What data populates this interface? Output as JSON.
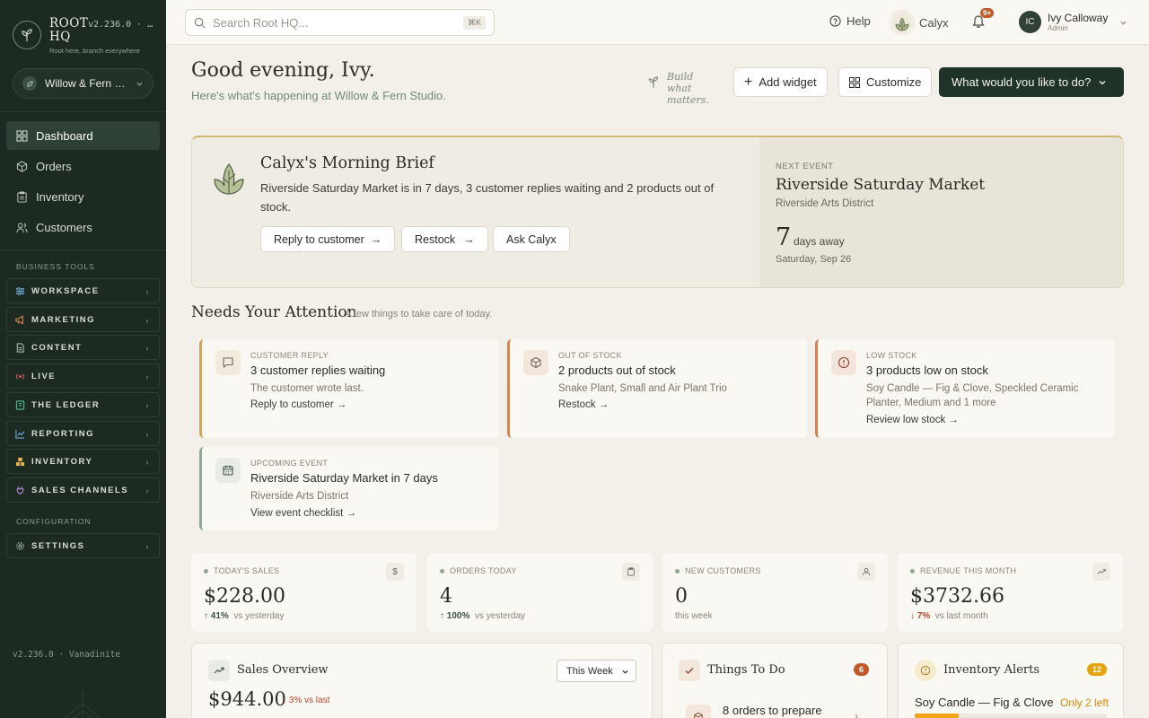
{
  "app": {
    "name": "ROOT HQ",
    "version": "v2.236.0 · …",
    "tagline": "Root here, branch everywhere",
    "org_name": "Willow & Fern …",
    "footer_version": "v2.236.0 · Vanadinite"
  },
  "nav": [
    {
      "label": "Dashboard",
      "icon": "grid-icon",
      "active": true
    },
    {
      "label": "Orders",
      "icon": "package-icon"
    },
    {
      "label": "Inventory",
      "icon": "clipboard-icon"
    },
    {
      "label": "Customers",
      "icon": "users-icon"
    }
  ],
  "business_tools_label": "BUSINESS TOOLS",
  "tools": [
    {
      "label": "WORKSPACE",
      "icon": "workspace-icon",
      "color": "#6fa8d6"
    },
    {
      "label": "MARKETING",
      "icon": "megaphone-icon",
      "color": "#e08a4a"
    },
    {
      "label": "CONTENT",
      "icon": "document-icon",
      "color": "#b8c4b9"
    },
    {
      "label": "LIVE",
      "icon": "live-icon",
      "color": "#e05a6a"
    },
    {
      "label": "THE LEDGER",
      "icon": "ledger-icon",
      "color": "#4fc08a"
    },
    {
      "label": "REPORTING",
      "icon": "chart-icon",
      "color": "#6fa8d6"
    },
    {
      "label": "INVENTORY",
      "icon": "boxes-icon",
      "color": "#e0b24a"
    },
    {
      "label": "SALES CHANNELS",
      "icon": "plug-icon",
      "color": "#b08ad6"
    }
  ],
  "configuration_label": "CONFIGURATION",
  "settings_label": "SETTINGS",
  "topbar": {
    "search_placeholder": "Search Root HQ...",
    "search_shortcut": "⌘K",
    "help": "Help",
    "calyx": "Calyx",
    "notif_count": "9+",
    "user_initials": "IC",
    "user_name": "Ivy Calloway",
    "user_role": "Admin"
  },
  "header": {
    "greeting": "Good evening, Ivy.",
    "subtitle": "Here's what's happening at Willow & Fern Studio.",
    "motto": "Build what matters.",
    "add_widget": "Add widget",
    "customize": "Customize",
    "action_menu": "What would you like to do?"
  },
  "brief": {
    "title": "Calyx's Morning Brief",
    "text": "Riverside Saturday Market is in 7 days, 3 customer replies waiting and 2 products out of stock.",
    "actions": [
      "Reply to customer",
      "Restock",
      "Ask Calyx"
    ],
    "next_event_label": "NEXT EVENT",
    "next_event_title": "Riverside Saturday Market",
    "next_event_location": "Riverside Arts District",
    "days": "7",
    "days_label": "days away",
    "date": "Saturday, Sep 26"
  },
  "attention": {
    "title": "Needs Your Attention",
    "subtitle": "A few things to take care of today.",
    "cards": [
      {
        "label": "CUSTOMER REPLY",
        "title": "3 customer replies waiting",
        "sub": "The customer wrote last.",
        "link": "Reply to customer →",
        "accent": "#d2a25a"
      },
      {
        "label": "OUT OF STOCK",
        "title": "2 products out of stock",
        "sub": "Snake Plant, Small and Air Plant Trio",
        "link": "Restock →",
        "accent": "#d4844f"
      },
      {
        "label": "LOW STOCK",
        "title": "3 products low on stock",
        "sub": "Soy Candle — Fig & Clove, Speckled Ceramic Planter, Medium and 1 more",
        "link": "Review low stock →",
        "accent": "#d4844f"
      },
      {
        "label": "UPCOMING EVENT",
        "title": "Riverside Saturday Market in 7 days",
        "sub": "Riverside Arts District",
        "link": "View event checklist →",
        "accent": "#8fa893"
      }
    ]
  },
  "stats": [
    {
      "label": "TODAY'S SALES",
      "value": "$228.00",
      "change": "↑ 41%",
      "compare": "vs yesterday",
      "icon": "dollar-icon"
    },
    {
      "label": "ORDERS TODAY",
      "value": "4",
      "change": "↑ 100%",
      "compare": "vs yesterday",
      "icon": "clipboard-icon"
    },
    {
      "label": "NEW CUSTOMERS",
      "value": "0",
      "change": "",
      "compare": "this week",
      "icon": "user-icon"
    },
    {
      "label": "REVENUE THIS MONTH",
      "value": "$3732.66",
      "change": "↓ 7%",
      "compare": "vs last month",
      "icon": "trend-icon"
    }
  ],
  "panels": {
    "sales_title": "Sales Overview",
    "sales_period": "This Week",
    "sales_value": "$944.00",
    "sales_change": "↓ 3% vs last",
    "todo_title": "Things To Do",
    "todo_count": "6",
    "todo_item": "8 orders to prepare",
    "inv_title": "Inventory Alerts",
    "inv_count": "12",
    "inv_item": "Soy Candle — Fig & Clove",
    "inv_item_status": "Only 2 left",
    "inv_item_level": 0.23
  }
}
